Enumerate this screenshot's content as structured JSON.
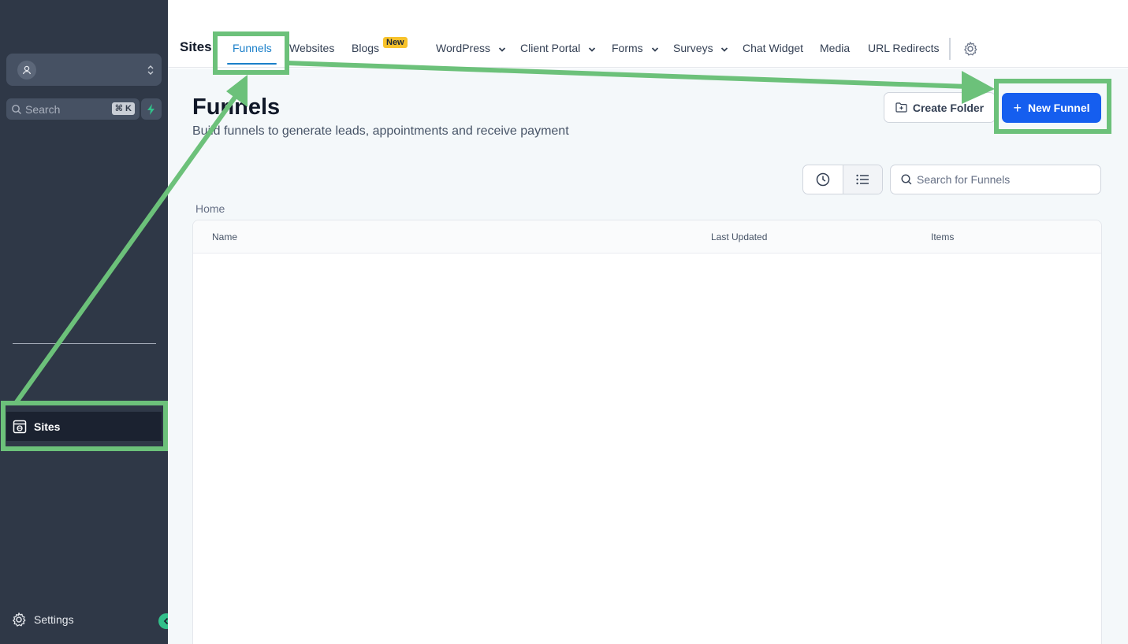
{
  "sidebar": {
    "search_placeholder": "Search",
    "search_shortcut": "⌘ K",
    "nav_active_label": "Sites",
    "settings_label": "Settings"
  },
  "topnav": {
    "section_title": "Sites",
    "tabs": [
      {
        "label": "Funnels",
        "active": true
      },
      {
        "label": "Websites"
      },
      {
        "label": "Blogs",
        "badge": "New"
      },
      {
        "label": "WordPress",
        "dropdown": true
      },
      {
        "label": "Client Portal",
        "dropdown": true
      },
      {
        "label": "Forms",
        "dropdown": true
      },
      {
        "label": "Surveys",
        "dropdown": true
      },
      {
        "label": "Chat Widget"
      },
      {
        "label": "Media"
      },
      {
        "label": "URL Redirects"
      }
    ]
  },
  "page": {
    "title": "Funnels",
    "subtitle": "Build funnels to generate leads, appointments and receive payment",
    "create_folder_label": "Create Folder",
    "new_funnel_label": "New Funnel",
    "search_placeholder": "Search for Funnels",
    "breadcrumb": "Home"
  },
  "table": {
    "columns": [
      "Name",
      "Last Updated",
      "Items"
    ],
    "rows": []
  },
  "colors": {
    "sidebar_bg": "#2f3847",
    "accent_blue": "#155eef",
    "active_tab": "#1a7fc9",
    "annotation_green": "#6cc17a",
    "badge_yellow": "#f7c22b"
  }
}
